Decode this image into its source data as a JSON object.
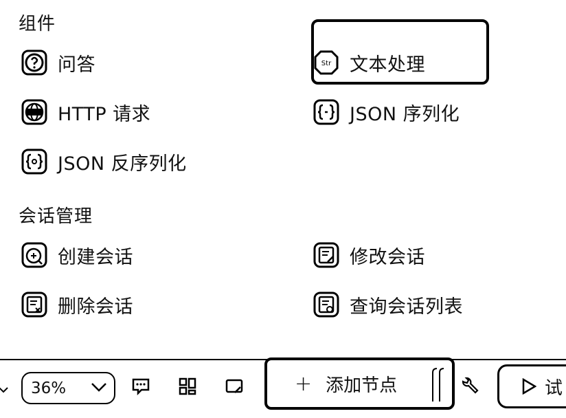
{
  "sections": [
    {
      "title": "组件",
      "items": [
        {
          "label": "问答",
          "icon": "question-icon"
        },
        {
          "label": "文本处理",
          "icon": "text-processing-icon"
        },
        {
          "label": "HTTP 请求",
          "icon": "globe-icon"
        },
        {
          "label": "JSON 序列化",
          "icon": "json-serialize-icon"
        },
        {
          "label": "JSON 反序列化",
          "icon": "json-deserialize-icon"
        }
      ]
    },
    {
      "title": "会话管理",
      "items": [
        {
          "label": "创建会话",
          "icon": "create-conversation-icon"
        },
        {
          "label": "修改会话",
          "icon": "edit-conversation-icon"
        },
        {
          "label": "删除会话",
          "icon": "delete-conversation-icon"
        },
        {
          "label": "查询会话列表",
          "icon": "list-conversation-icon"
        }
      ]
    }
  ],
  "icon_text": {
    "text_processing": "Str"
  },
  "toolbar": {
    "zoom": "36%",
    "add_node_plus": "+",
    "add_node_label": "添加节点",
    "run_label": "试"
  }
}
